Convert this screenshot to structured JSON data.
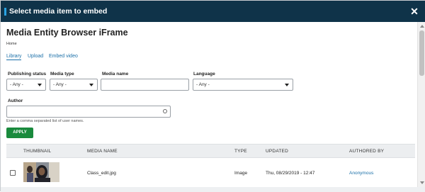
{
  "dialog": {
    "title": "Select media item to embed",
    "close_symbol": "✕"
  },
  "page": {
    "title": "Media Entity Browser iFrame",
    "breadcrumb": "Home"
  },
  "tabs": [
    {
      "label": "Library",
      "active": true
    },
    {
      "label": "Upload",
      "active": false
    },
    {
      "label": "Embed video",
      "active": false
    }
  ],
  "filters": {
    "publishing_status": {
      "label": "Publishing status",
      "value": "- Any -"
    },
    "media_type": {
      "label": "Media type",
      "value": "- Any -"
    },
    "media_name": {
      "label": "Media name",
      "value": ""
    },
    "language": {
      "label": "Language",
      "value": "- Any -"
    },
    "author": {
      "label": "Author",
      "value": "",
      "description": "Enter a comma separated list of user names."
    },
    "apply_label": "APPLY"
  },
  "table": {
    "headers": [
      "THUMBNAIL",
      "MEDIA NAME",
      "TYPE",
      "UPDATED",
      "AUTHORED BY"
    ],
    "rows": [
      {
        "media_name": "Class_edit.jpg",
        "type": "Image",
        "updated": "Thu, 08/29/2019 - 12:47",
        "authored_by": "Anonymous"
      }
    ]
  },
  "colors": {
    "titlebar": "#0f3349",
    "accent": "#2aa3e3",
    "apply_button": "#1a8a3d",
    "link": "#1a6fa8"
  }
}
